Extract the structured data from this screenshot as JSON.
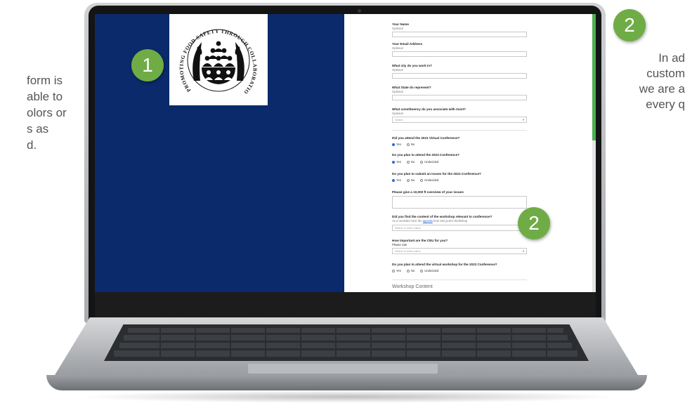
{
  "slide": {
    "left_text": [
      "form is",
      "able to",
      "olors or",
      "s as",
      "d."
    ],
    "right_text": [
      "In ad",
      "custom",
      "we are a",
      "every q"
    ],
    "badges": [
      "2",
      "1",
      "2"
    ]
  },
  "logo": {
    "ring_text": "PROMOTING FOOD SAFETY THROUGH COLLABORATION",
    "ring_text_top": "PROMOTING FOOD SAFETY THROUGH COLL",
    "ring_text_right": "ABORATION"
  },
  "form": {
    "name_label": "Your Name",
    "name_sub": "Optional",
    "email_label": "Your Email Address",
    "email_sub": "Optional",
    "city_label": "What city do you work in?",
    "city_sub": "Optional",
    "state_label": "What State do represent?",
    "state_sub": "Optional",
    "constituency_label": "What constituency do you associate with most?",
    "constituency_sub": "Optional",
    "constituency_value": "Select",
    "attend2021_label": "Did you attend the 2021 Virtual Conference?",
    "attend2021_options": [
      "Yes",
      "No"
    ],
    "attend2023_label": "Do you plan to attend the 2023 Conference?",
    "attend2023_options": [
      "Yes",
      "No",
      "Undecided"
    ],
    "submit_label": "Do you plan to submit an issues for the 2023 Conference?",
    "submit_options": [
      "Yes",
      "No",
      "Undecided"
    ],
    "overview_label": "Please give a 10,000 ft overview of your issues",
    "relevant_label": "Did you find the content of the workshop relevant to conference?",
    "relevant_sub_pre": "As a reminder here the",
    "relevant_link": "agenda",
    "relevant_sub_post": "from last year's Workshop",
    "relevant_placeholder": "Select or enter value",
    "ceu_label": "How important are the CEU for you?",
    "ceu_sub": "Please rate",
    "ceu_placeholder": "Select or enter value",
    "virtual_label": "Do you plan to attend the virtual workshop for the 2023 Conference?",
    "virtual_options": [
      "Yes",
      "No",
      "Undecided"
    ],
    "section_title": "Workshop Content"
  },
  "colors": {
    "left_panel": "#0b2a6b",
    "badge": "#6fac46",
    "accent": "#4caf50",
    "radio_selected": "#2a6ad8"
  }
}
